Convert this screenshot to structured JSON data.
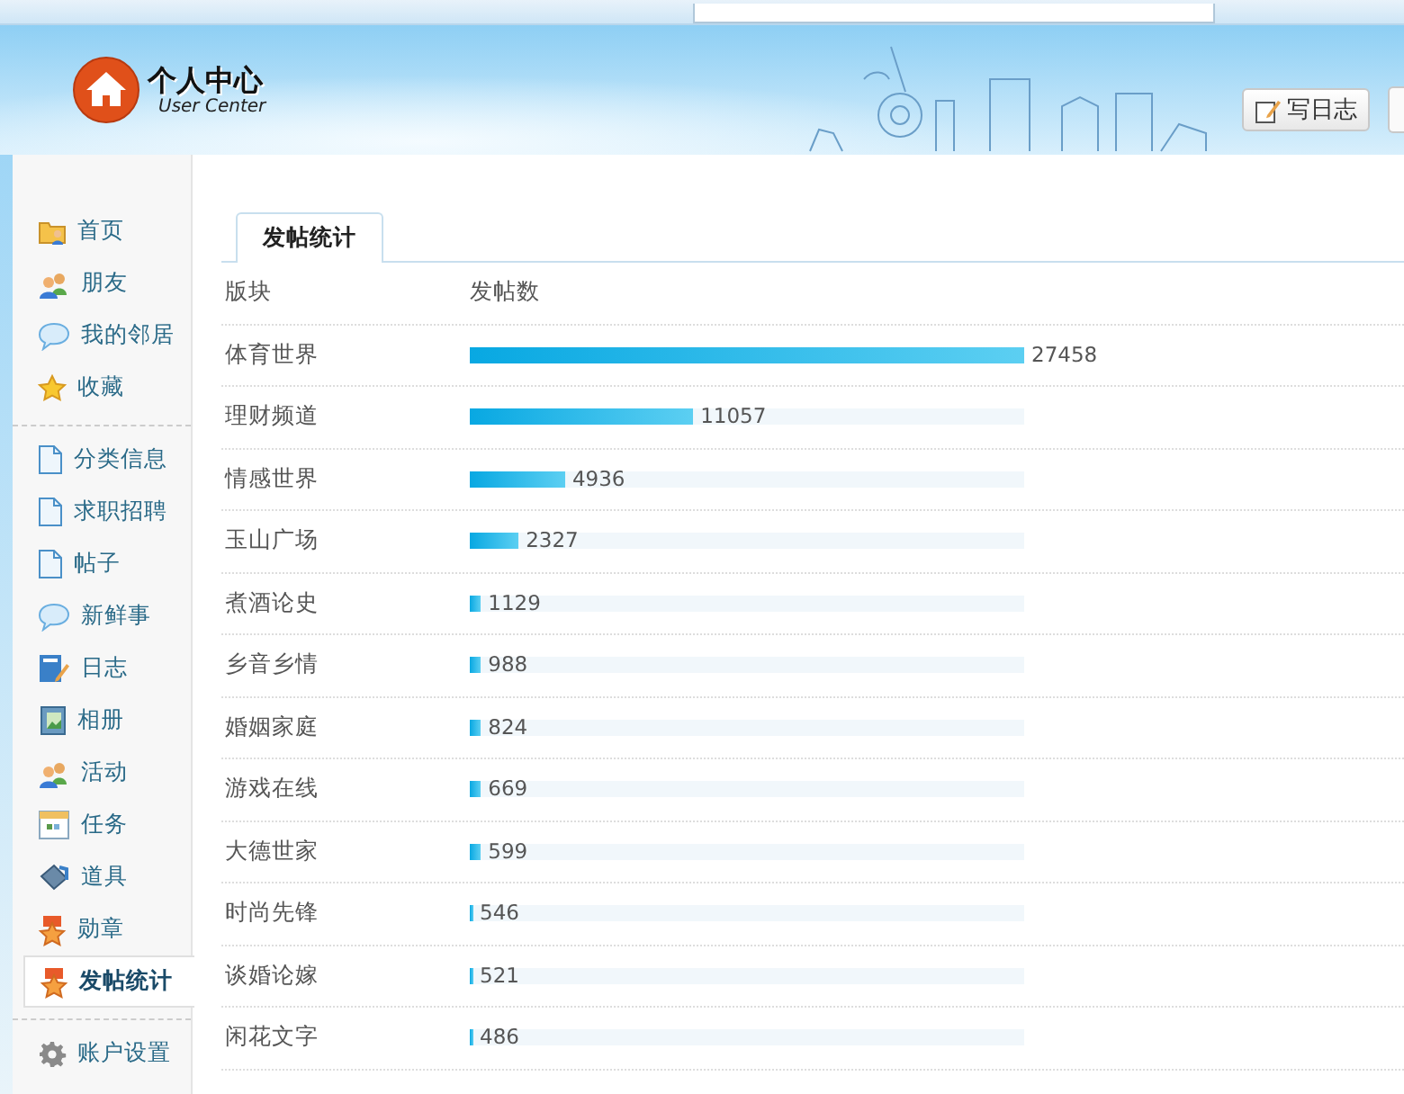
{
  "header": {
    "logo_title": "个人中心",
    "logo_subtitle": "User Center",
    "write_button": "写日志"
  },
  "sidebar": {
    "groups": [
      [
        {
          "label": "首页",
          "selected": false
        },
        {
          "label": "朋友",
          "selected": false
        },
        {
          "label": "我的邻居",
          "selected": false
        },
        {
          "label": "收藏",
          "selected": false
        }
      ],
      [
        {
          "label": "分类信息",
          "selected": false
        },
        {
          "label": "求职招聘",
          "selected": false
        },
        {
          "label": "帖子",
          "selected": false
        },
        {
          "label": "新鲜事",
          "selected": false
        },
        {
          "label": "日志",
          "selected": false
        },
        {
          "label": "相册",
          "selected": false
        },
        {
          "label": "活动",
          "selected": false
        },
        {
          "label": "任务",
          "selected": false
        },
        {
          "label": "道具",
          "selected": false
        },
        {
          "label": "勋章",
          "selected": false
        },
        {
          "label": "发帖统计",
          "selected": true
        }
      ],
      [
        {
          "label": "账户设置",
          "selected": false
        }
      ]
    ]
  },
  "panel": {
    "tabs": [
      {
        "label": "发帖统计",
        "selected": true
      }
    ],
    "columns": [
      "版块",
      "发帖数"
    ],
    "rows": [
      {
        "board": "体育世界",
        "count": "27458",
        "level": 1.0
      },
      {
        "board": "理财频道",
        "count": "11057",
        "level": 0.403
      },
      {
        "board": "情感世界",
        "count": "4936",
        "level": 0.172
      },
      {
        "board": "玉山广场",
        "count": "2327",
        "level": 0.088
      },
      {
        "board": "煮酒论史",
        "count": "1129",
        "level": 0.02
      },
      {
        "board": "乡音乡情",
        "count": "988",
        "level": 0.02
      },
      {
        "board": "婚姻家庭",
        "count": "824",
        "level": 0.02
      },
      {
        "board": "游戏在线",
        "count": "669",
        "level": 0.02
      },
      {
        "board": "大德世家",
        "count": "599",
        "level": 0.02
      },
      {
        "board": "时尚先锋",
        "count": "546",
        "level": 0.005
      },
      {
        "board": "谈婚论嫁",
        "count": "521",
        "level": 0.005
      },
      {
        "board": "闲花文字",
        "count": "486",
        "level": 0.005
      }
    ]
  }
}
